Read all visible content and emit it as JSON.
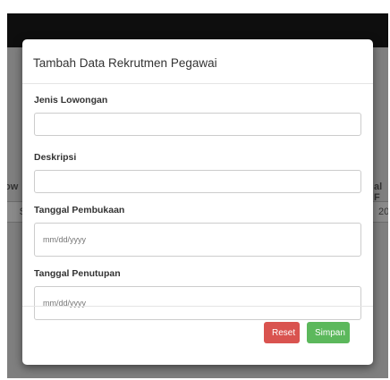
{
  "background": {
    "left_header_fragment": "ow",
    "right_header_fragment": "al F",
    "left_cell_fragment": "S",
    "right_cell_fragment": "20"
  },
  "modal": {
    "title": "Tambah Data Rekrutmen Pegawai",
    "fields": {
      "jenis_lowongan": {
        "label": "Jenis Lowongan",
        "value": ""
      },
      "deskripsi": {
        "label": "Deskripsi",
        "value": ""
      },
      "tanggal_pembukaan": {
        "label": "Tanggal Pembukaan",
        "placeholder": "mm/dd/yyyy"
      },
      "tanggal_penutupan": {
        "label": "Tanggal Penutupan",
        "placeholder": "mm/dd/yyyy"
      }
    },
    "buttons": {
      "reset_label": "Reset",
      "save_label": "Simpan"
    }
  },
  "colors": {
    "overlay": "#777777",
    "topbar": "#0e0e0e",
    "reset": "#d9534f",
    "save": "#5cb85c"
  }
}
